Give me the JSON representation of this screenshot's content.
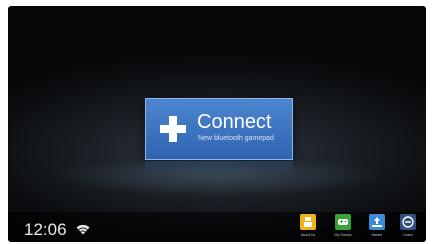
{
  "connect_tile": {
    "title": "Connect",
    "subtitle": "New bluetooth gamepad"
  },
  "status_bar": {
    "time": "12:06",
    "wifi_icon": "wifi-icon"
  },
  "dock": {
    "items": [
      {
        "label": "About Us",
        "icon": "info-icon",
        "color": "#f2b21c"
      },
      {
        "label": "My Games",
        "icon": "gamepad-icon",
        "color": "#3aa23c"
      },
      {
        "label": "Market",
        "icon": "market-icon",
        "color": "#3b8ad9"
      },
      {
        "label": "Users",
        "icon": "users-icon",
        "color": "#34507f"
      }
    ]
  },
  "colors": {
    "tile_blue": "#3a71bf",
    "background": "#0b0d10"
  }
}
